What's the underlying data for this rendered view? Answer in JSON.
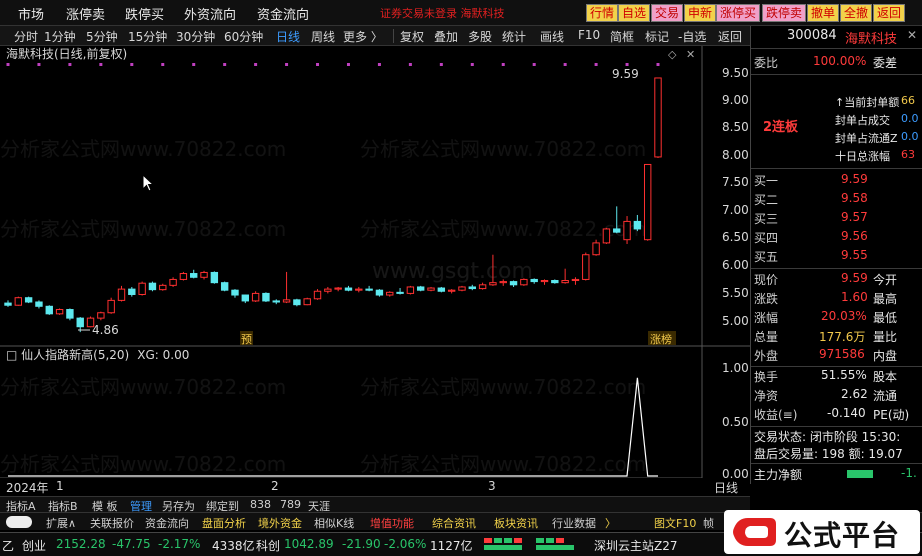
{
  "topbar": {
    "menu": [
      "市场",
      "涨停卖",
      "跌停买",
      "外资流向",
      "资金流向"
    ],
    "warning": "证券交易未登录  海默科技",
    "buttons": [
      "行情",
      "自选",
      "交易",
      "申新",
      "涨停买",
      "跌停卖",
      "撤单",
      "全撤",
      "返回"
    ]
  },
  "periodbar": {
    "items": [
      "分时",
      "1分钟",
      "5分钟",
      "15分钟",
      "30分钟",
      "60分钟",
      "日线",
      "周线",
      "更多 〉"
    ],
    "active": "日线",
    "tools": [
      "复权",
      "叠加",
      "多股",
      "统计",
      "画线",
      "F10",
      "简框",
      "标记",
      "-自选",
      "返回"
    ]
  },
  "chart": {
    "title": "海默科技(日线,前复权)",
    "price_labels": [
      "9.50",
      "9.00",
      "8.50",
      "8.00",
      "7.50",
      "7.00",
      "6.50",
      "6.00",
      "5.50",
      "5.00"
    ],
    "high_label": "9.59",
    "low_label": "4.86",
    "marker_yu": "预",
    "marker_zb": "涨榜",
    "indicator_title": "仙人指路新高(5,20)",
    "indicator_value": "XG: 0.00",
    "indicator_labels": [
      "1.00",
      "0.50",
      "0.00"
    ],
    "axis_year": "2024年",
    "axis_months": [
      "1",
      "2",
      "3"
    ],
    "axis_period": "日线",
    "watermark": "分析家公式网www.70822.com",
    "watermark2": "www.gsgt.com"
  },
  "chart_data": {
    "type": "candlestick",
    "ohlc": [
      [
        5.4,
        5.45,
        5.33,
        5.36
      ],
      [
        5.36,
        5.52,
        5.35,
        5.5
      ],
      [
        5.5,
        5.52,
        5.4,
        5.42
      ],
      [
        5.42,
        5.45,
        5.3,
        5.34
      ],
      [
        5.34,
        5.36,
        5.18,
        5.2
      ],
      [
        5.2,
        5.3,
        5.18,
        5.28
      ],
      [
        5.28,
        5.3,
        5.08,
        5.12
      ],
      [
        5.12,
        5.14,
        4.86,
        4.96
      ],
      [
        4.96,
        5.15,
        4.95,
        5.12
      ],
      [
        5.12,
        5.24,
        5.08,
        5.22
      ],
      [
        5.22,
        5.5,
        5.2,
        5.45
      ],
      [
        5.45,
        5.72,
        5.43,
        5.66
      ],
      [
        5.66,
        5.7,
        5.52,
        5.56
      ],
      [
        5.56,
        5.8,
        5.54,
        5.77
      ],
      [
        5.77,
        5.8,
        5.62,
        5.65
      ],
      [
        5.65,
        5.76,
        5.63,
        5.73
      ],
      [
        5.73,
        5.88,
        5.7,
        5.84
      ],
      [
        5.84,
        5.98,
        5.82,
        5.95
      ],
      [
        5.95,
        6.02,
        5.86,
        5.88
      ],
      [
        5.88,
        6.0,
        5.84,
        5.97
      ],
      [
        5.97,
        5.99,
        5.76,
        5.78
      ],
      [
        5.78,
        5.8,
        5.62,
        5.64
      ],
      [
        5.64,
        5.66,
        5.5,
        5.55
      ],
      [
        5.55,
        5.56,
        5.4,
        5.44
      ],
      [
        5.44,
        5.62,
        5.42,
        5.58
      ],
      [
        5.58,
        5.6,
        5.42,
        5.44
      ],
      [
        5.44,
        5.47,
        5.38,
        5.42
      ],
      [
        5.42,
        5.98,
        5.4,
        5.46
      ],
      [
        5.46,
        5.48,
        5.34,
        5.37
      ],
      [
        5.37,
        5.5,
        5.36,
        5.48
      ],
      [
        5.48,
        5.66,
        5.46,
        5.62
      ],
      [
        5.62,
        5.7,
        5.58,
        5.66
      ],
      [
        5.66,
        5.7,
        5.62,
        5.68
      ],
      [
        5.68,
        5.72,
        5.62,
        5.64
      ],
      [
        5.64,
        5.7,
        5.6,
        5.66
      ],
      [
        5.66,
        5.72,
        5.62,
        5.64
      ],
      [
        5.64,
        5.66,
        5.52,
        5.55
      ],
      [
        5.55,
        5.62,
        5.52,
        5.6
      ],
      [
        5.6,
        5.68,
        5.56,
        5.58
      ],
      [
        5.58,
        5.72,
        5.56,
        5.7
      ],
      [
        5.7,
        5.72,
        5.62,
        5.64
      ],
      [
        5.64,
        5.7,
        5.62,
        5.68
      ],
      [
        5.68,
        5.7,
        5.6,
        5.62
      ],
      [
        5.62,
        5.66,
        5.58,
        5.64
      ],
      [
        5.64,
        5.72,
        5.62,
        5.7
      ],
      [
        5.7,
        5.74,
        5.64,
        5.67
      ],
      [
        5.67,
        5.78,
        5.65,
        5.74
      ],
      [
        5.74,
        6.3,
        5.72,
        5.78
      ],
      [
        5.78,
        5.84,
        5.72,
        5.8
      ],
      [
        5.8,
        5.82,
        5.7,
        5.74
      ],
      [
        5.74,
        5.86,
        5.72,
        5.84
      ],
      [
        5.84,
        5.86,
        5.76,
        5.8
      ],
      [
        5.8,
        5.84,
        5.74,
        5.82
      ],
      [
        5.82,
        5.84,
        5.76,
        5.78
      ],
      [
        5.78,
        6.04,
        5.76,
        5.82
      ],
      [
        5.82,
        5.88,
        5.74,
        5.84
      ],
      [
        5.84,
        6.34,
        5.82,
        6.3
      ],
      [
        6.3,
        6.58,
        6.28,
        6.52
      ],
      [
        6.52,
        6.8,
        6.5,
        6.78
      ],
      [
        6.78,
        7.2,
        6.7,
        6.72
      ],
      [
        6.58,
        7.02,
        6.5,
        6.92
      ],
      [
        6.92,
        7.04,
        6.74,
        6.78
      ],
      [
        6.58,
        7.98,
        6.56,
        7.98
      ],
      [
        8.12,
        9.59,
        8.1,
        9.59
      ]
    ],
    "indicator": [
      0,
      0,
      0,
      0,
      0,
      0,
      0,
      0,
      0,
      0,
      0,
      0,
      0,
      0,
      0,
      0,
      0,
      0,
      0,
      0,
      0,
      0,
      0,
      0,
      0,
      0,
      0,
      0,
      0,
      0,
      0,
      0,
      0,
      0,
      0,
      0,
      0,
      0,
      0,
      0,
      0,
      0,
      0,
      0,
      0,
      0,
      0,
      0,
      0,
      0,
      0,
      0,
      0,
      0,
      0,
      0,
      0,
      0,
      0,
      0,
      0,
      1,
      0,
      0
    ],
    "ylim": [
      4.75,
      9.85
    ],
    "indicator_ylim": [
      0,
      1.1
    ],
    "colors": {
      "up": "#ff3030",
      "down": "#5de8ee",
      "indicator": "#ffffff"
    }
  },
  "panel": {
    "code": "300084",
    "name": "海默科技",
    "weibi_label": "委比",
    "weibi_value": "100.00%",
    "weicha_label": "委差",
    "lianban": "2连板",
    "stats": [
      {
        "label": "↑当前封单额",
        "value": "66"
      },
      {
        "label": "封单占成交",
        "value": "0.0"
      },
      {
        "label": "封单占流通Z",
        "value": "0.0"
      },
      {
        "label": "十日总涨幅",
        "value": "63"
      }
    ],
    "bids": [
      {
        "label": "买一",
        "value": "9.59"
      },
      {
        "label": "买二",
        "value": "9.58"
      },
      {
        "label": "买三",
        "value": "9.57"
      },
      {
        "label": "买四",
        "value": "9.56"
      },
      {
        "label": "买五",
        "value": "9.55"
      }
    ],
    "quote": [
      {
        "l1": "现价",
        "v1": "9.59",
        "l2": "今开"
      },
      {
        "l1": "涨跌",
        "v1": "1.60",
        "l2": "最高"
      },
      {
        "l1": "涨幅",
        "v1": "20.03%",
        "l2": "最低"
      },
      {
        "l1": "总量",
        "v1": "177.6万",
        "l2": "量比"
      },
      {
        "l1": "外盘",
        "v1": "971586",
        "l2": "内盘"
      }
    ],
    "quote2": [
      {
        "l1": "换手",
        "v1": "51.55%",
        "l2": "股本"
      },
      {
        "l1": "净资",
        "v1": "2.62",
        "l2": "流通"
      },
      {
        "l1": "收益(≡)",
        "v1": "-0.140",
        "l2": "PE(动)"
      }
    ],
    "trade_state": "交易状态: 闭市阶段 15:30:",
    "after_hours": "盘后交易量: 198  额: 19.07",
    "main_flow": "主力净额",
    "main_flow_val": "-1.",
    "time_row": "15:30",
    "time_price": "9.59"
  },
  "tabs1": [
    "指标A",
    "指标B",
    "模 板",
    "管理",
    "另存为",
    "绑定到",
    "838",
    "789",
    "天涯"
  ],
  "tabs1_active": "管理",
  "tabs2": [
    "扩展∧",
    "关联报价",
    "资金流向",
    "盘面分析",
    "境外资金",
    "相似K线",
    "增值功能",
    "综合资讯",
    "板块资讯",
    "行业数据",
    "〉",
    "图文F10",
    "帧"
  ],
  "status": {
    "items": [
      {
        "label": "乙",
        "color": "wht"
      },
      {
        "label": "创业",
        "color": "wht"
      },
      {
        "label": "2152.28",
        "color": "grn"
      },
      {
        "label": "-47.75",
        "color": "grn"
      },
      {
        "label": "-2.17%",
        "color": "grn"
      },
      {
        "label": "4338亿",
        "color": "wht"
      },
      {
        "label": "科创",
        "color": "wht"
      },
      {
        "label": "1042.89",
        "color": "grn"
      },
      {
        "label": "-21.90",
        "color": "grn"
      },
      {
        "label": "-2.06%",
        "color": "grn"
      },
      {
        "label": "1127亿",
        "color": "wht"
      },
      {
        "label": "深圳云主站Z27",
        "color": "wht"
      }
    ]
  },
  "logo": {
    "text": "公式平台",
    "url": "www.gsgt.com"
  }
}
